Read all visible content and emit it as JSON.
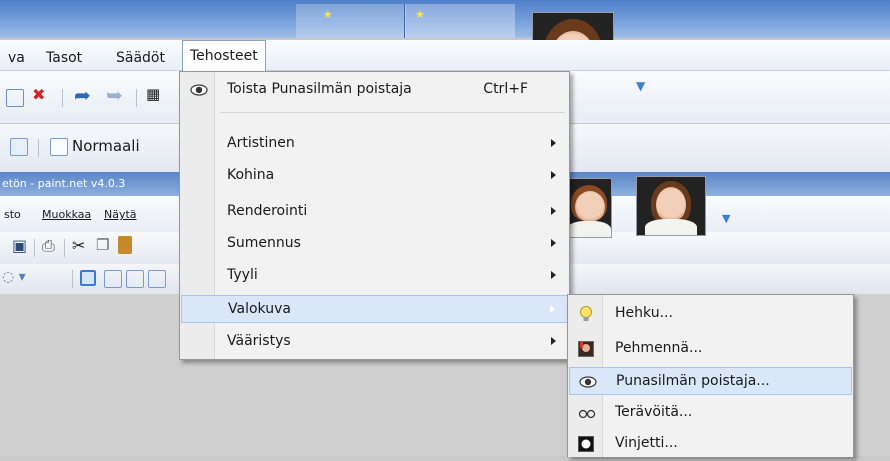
{
  "top_window": {
    "menus": [
      {
        "label": "va"
      },
      {
        "label": "Tasot"
      },
      {
        "label": "Säädöt"
      },
      {
        "label": "Tehosteet"
      }
    ],
    "toolbar_mode_label": "Normaali"
  },
  "second_window": {
    "title": "etön - paint.net v4.0.3",
    "menus": [
      {
        "label": "sto"
      },
      {
        "label": "Muokkaa"
      },
      {
        "label": "Näytä"
      }
    ]
  },
  "effects_menu": {
    "repeat_item": {
      "label": "Toista Punasilmän poistaja",
      "shortcut": "Ctrl+F",
      "icon": "eye-icon"
    },
    "items": [
      {
        "label": "Artistinen",
        "has_submenu": true
      },
      {
        "label": "Kohina",
        "has_submenu": true
      },
      {
        "label": "Renderointi",
        "has_submenu": true
      },
      {
        "label": "Sumennus",
        "has_submenu": true
      },
      {
        "label": "Tyyli",
        "has_submenu": true
      },
      {
        "label": "Valokuva",
        "has_submenu": true,
        "highlighted": true
      },
      {
        "label": "Vääristys",
        "has_submenu": true
      }
    ]
  },
  "photo_submenu": {
    "items": [
      {
        "label": "Hehku...",
        "icon": "lightbulb-icon"
      },
      {
        "label": "Pehmennä...",
        "icon": "soften-photo-icon"
      },
      {
        "label": "Punasilmän poistaja...",
        "icon": "eye-icon",
        "highlighted": true
      },
      {
        "label": "Terävöitä...",
        "icon": "glasses-icon"
      },
      {
        "label": "Vinjetti...",
        "icon": "vignette-icon"
      }
    ]
  }
}
